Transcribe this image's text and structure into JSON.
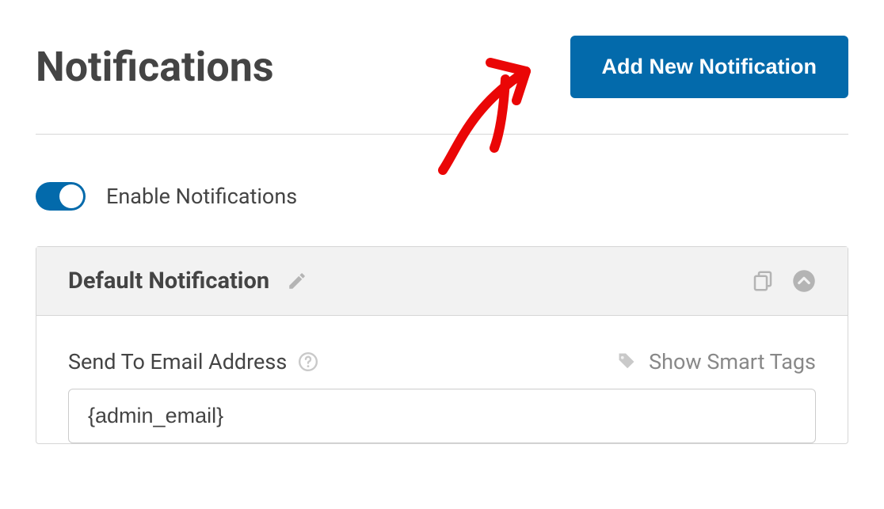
{
  "header": {
    "title": "Notifications",
    "add_button_label": "Add New Notification"
  },
  "enable": {
    "label": "Enable Notifications",
    "on": true
  },
  "notification": {
    "title": "Default Notification",
    "send_to": {
      "label": "Send To Email Address",
      "value": "{admin_email}"
    },
    "smart_tags_label": "Show Smart Tags"
  }
}
